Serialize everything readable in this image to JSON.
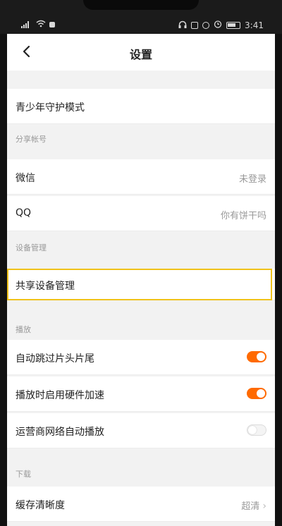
{
  "status": {
    "time": "3:41"
  },
  "nav": {
    "title": "设置"
  },
  "youth": {
    "label": "青少年守护模式"
  },
  "share_section": {
    "title": "分享帐号"
  },
  "wechat": {
    "label": "微信",
    "value": "未登录"
  },
  "qq": {
    "label": "QQ",
    "value": "你有饼干吗"
  },
  "device_section": {
    "title": "设备管理"
  },
  "device_manage": {
    "label": "共享设备管理"
  },
  "play_section": {
    "title": "播放"
  },
  "skip_intro": {
    "label": "自动跳过片头片尾",
    "enabled": true
  },
  "hw_accel": {
    "label": "播放时启用硬件加速",
    "enabled": true
  },
  "carrier_autoplay": {
    "label": "运营商网络自动播放",
    "enabled": false
  },
  "download_section": {
    "title": "下载"
  },
  "cache_quality": {
    "label": "缓存清晰度",
    "value": "超清"
  },
  "colors": {
    "accent": "#ff6a00",
    "highlight": "#f0c21a"
  }
}
